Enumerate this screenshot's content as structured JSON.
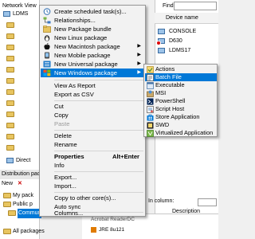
{
  "background": {
    "tree_title": "Network View",
    "tree_items": [
      "LDMS",
      "Direct"
    ],
    "find_label": "Find:",
    "device_header": "Device name",
    "devices": [
      "CONSOLE",
      "D630",
      "LDMS17"
    ],
    "column_label": "In column:",
    "column_value": "Any",
    "description_header": "Description",
    "dist_title": "Distribution packages",
    "dist_toolbar": "New",
    "dist_items": [
      "My pack",
      "Public p",
      "Commun",
      "All packages"
    ],
    "bottom_rows": [
      "Acrobat ReaderDC",
      "JRE 8u121"
    ]
  },
  "menu": {
    "items": [
      {
        "label": "Create scheduled task(s)...",
        "icon": "clock-icon"
      },
      {
        "label": "Relationships...",
        "icon": "relationships-icon"
      },
      {
        "label": "New Package bundle",
        "icon": "bundle-icon"
      },
      {
        "label": "New Linux package",
        "icon": "linux-icon"
      },
      {
        "label": "New Macintosh package",
        "icon": "apple-icon",
        "submenu": true
      },
      {
        "label": "New Mobile package",
        "icon": "mobile-icon",
        "submenu": true
      },
      {
        "label": "New Universal package",
        "icon": "universal-icon",
        "submenu": true
      },
      {
        "label": "New Windows package",
        "icon": "windows-icon",
        "submenu": true,
        "highlighted": true
      },
      {
        "label": "View As Report"
      },
      {
        "label": "Export as CSV"
      },
      {
        "label": "Cut"
      },
      {
        "label": "Copy"
      },
      {
        "label": "Paste",
        "disabled": true
      },
      {
        "label": "Delete"
      },
      {
        "label": "Rename"
      },
      {
        "label": "Properties",
        "shortcut": "Alt+Enter",
        "bold": true
      },
      {
        "label": "Info"
      },
      {
        "label": "Export..."
      },
      {
        "label": "Import..."
      },
      {
        "label": "Copy to other core(s)..."
      },
      {
        "label": "Auto sync"
      },
      {
        "label": "Columns..."
      }
    ]
  },
  "submenu": {
    "items": [
      {
        "label": "Actions",
        "icon": "actions-icon"
      },
      {
        "label": "Batch File",
        "icon": "batch-file-icon",
        "highlighted": true
      },
      {
        "label": "Executable",
        "icon": "executable-icon"
      },
      {
        "label": "MSI",
        "icon": "msi-icon"
      },
      {
        "label": "PowerShell",
        "icon": "powershell-icon"
      },
      {
        "label": "Script Host",
        "icon": "script-host-icon"
      },
      {
        "label": "Store Application",
        "icon": "store-icon"
      },
      {
        "label": "SWD",
        "icon": "swd-icon"
      },
      {
        "label": "Virtualized Application",
        "icon": "virtualized-app-icon"
      }
    ]
  }
}
